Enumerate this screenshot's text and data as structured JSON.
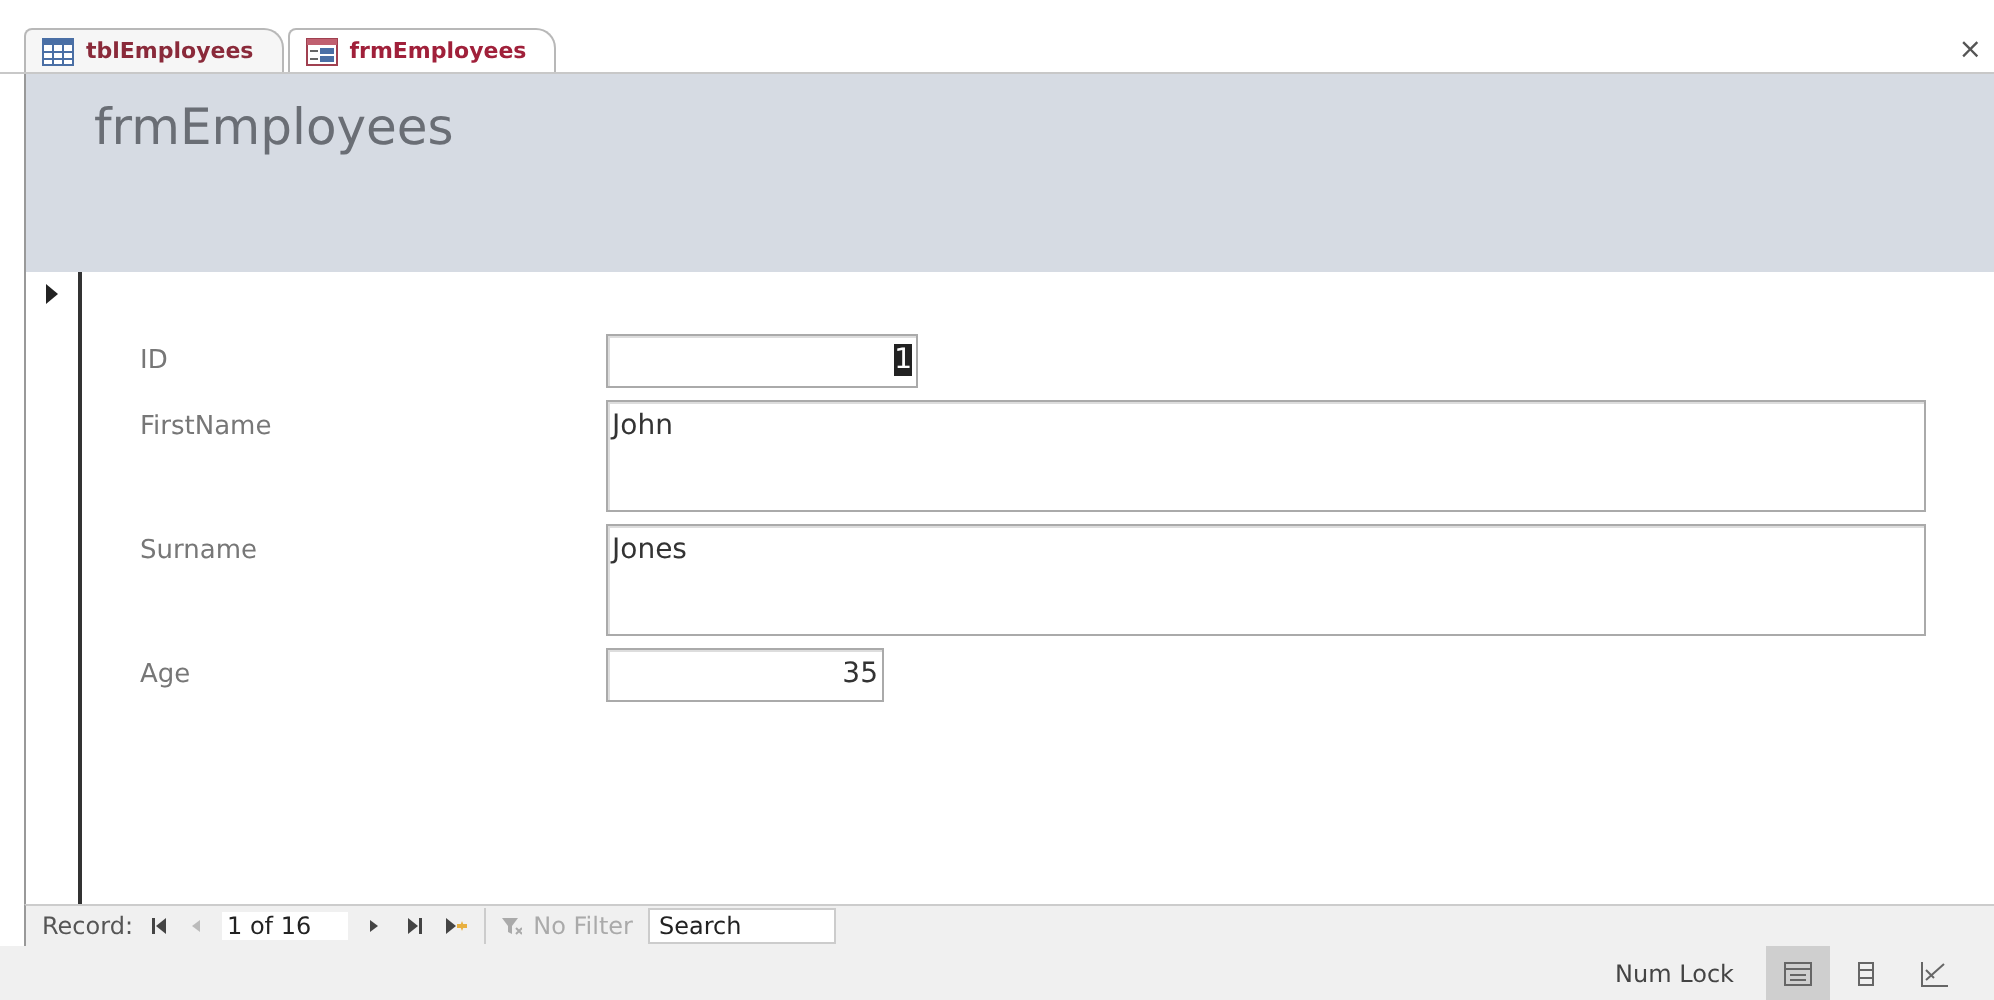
{
  "tabs": [
    {
      "label": "tblEmployees",
      "kind": "table",
      "selected": false
    },
    {
      "label": "frmEmployees",
      "kind": "form",
      "selected": true
    }
  ],
  "close": "×",
  "form": {
    "title": "frmEmployees",
    "fields": [
      {
        "label": "ID",
        "value": "1",
        "kind": "autonumber",
        "selected": true
      },
      {
        "label": "FirstName",
        "value": "John",
        "kind": "text",
        "selected": false
      },
      {
        "label": "Surname",
        "value": "Jones",
        "kind": "text",
        "selected": false
      },
      {
        "label": "Age",
        "value": "35",
        "kind": "number",
        "selected": false
      }
    ]
  },
  "navigation": {
    "label": "Record:",
    "position": "1 of 16",
    "buttons": [
      {
        "kind": "first",
        "disabled": false
      },
      {
        "kind": "prev",
        "disabled": true
      },
      {
        "kind": "next",
        "disabled": false
      },
      {
        "kind": "last",
        "disabled": false
      },
      {
        "kind": "new",
        "disabled": false
      }
    ],
    "filter": {
      "label": "No Filter",
      "disabled": true
    },
    "search": {
      "placeholder": "Search"
    }
  },
  "status_bar": {
    "text": "Num Lock",
    "views": [
      {
        "kind": "form",
        "selected": true
      },
      {
        "kind": "layout",
        "selected": false
      },
      {
        "kind": "design",
        "selected": false
      }
    ]
  }
}
